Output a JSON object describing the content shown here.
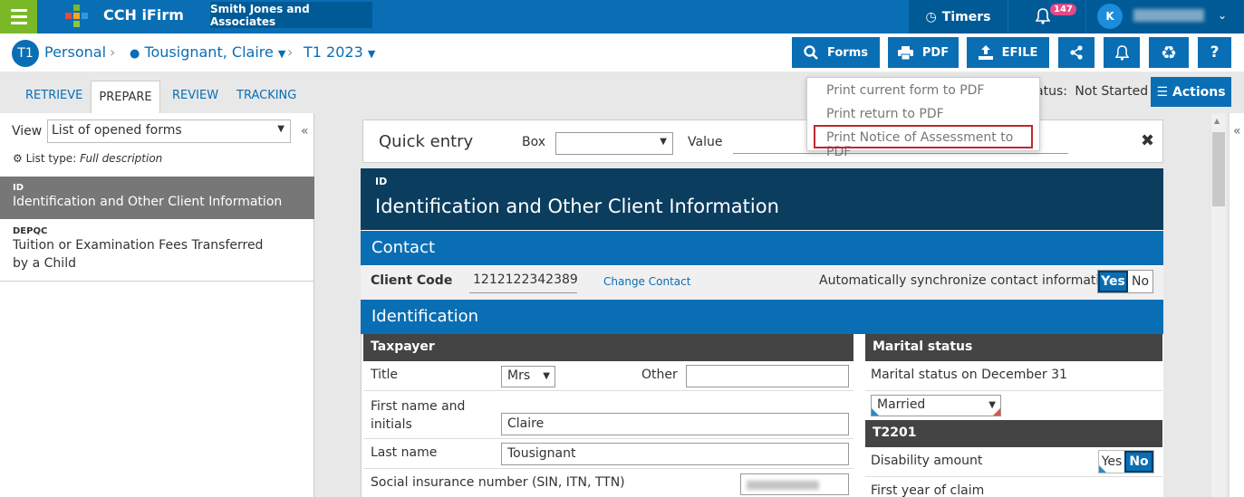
{
  "topbar": {
    "app_title": "CCH iFirm",
    "firm": "Smith Jones and Associates",
    "timers_label": "Timers",
    "notification_count": "147",
    "avatar_initial": "K"
  },
  "nav": {
    "badge": "T1",
    "crumb_personal": "Personal",
    "crumb_client": "Tousignant, Claire",
    "crumb_year": "T1 2023",
    "forms_label": "Forms",
    "pdf_label": "PDF",
    "efile_label": "EFILE"
  },
  "tabs": [
    "RETRIEVE",
    "PREPARE",
    "REVIEW",
    "TRACKING"
  ],
  "status": {
    "label": "atus:",
    "value": "Not Started"
  },
  "actions_label": "Actions",
  "pdf_menu": [
    "Print current form to PDF",
    "Print return to PDF",
    "Print Notice of Assessment to PDF"
  ],
  "left": {
    "view_label": "View",
    "view_value": "List of opened forms",
    "list_type_prefix": "List type:",
    "list_type_value": "Full description",
    "forms": [
      {
        "code": "ID",
        "desc": "Identification and Other Client Information"
      },
      {
        "code": "DEPQC",
        "desc": "Tuition or Examination Fees Transferred by a Child"
      }
    ]
  },
  "quick_entry": {
    "title": "Quick entry",
    "box_label": "Box",
    "value_label": "Value"
  },
  "form": {
    "code": "ID",
    "title": "Identification and Other Client Information",
    "contact_section": "Contact",
    "client_code_label": "Client Code",
    "client_code_value": "1212122342389",
    "change_contact": "Change Contact",
    "sync_label": "Automatically synchronize contact information",
    "yes": "Yes",
    "no": "No",
    "identification_section": "Identification",
    "taxpayer_head": "Taxpayer",
    "title_label": "Title",
    "title_value": "Mrs",
    "other_label": "Other",
    "first_name_label": "First name and initials",
    "first_name_value": "Claire",
    "last_name_label": "Last name",
    "last_name_value": "Tousignant",
    "sin_label": "Social insurance number (SIN, ITN, TTN)",
    "marital_head": "Marital status",
    "marital_dec31_label": "Marital status on December 31",
    "marital_value": "Married",
    "t2201_head": "T2201",
    "disability_label": "Disability amount",
    "first_year_label": "First year of claim"
  }
}
